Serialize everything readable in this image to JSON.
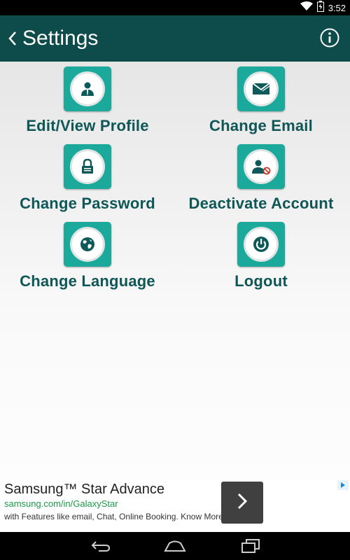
{
  "status_bar": {
    "time": "3:52",
    "icons": [
      "wifi-icon",
      "battery-icon"
    ]
  },
  "app_bar": {
    "title": "Settings",
    "back_icon": "chevron-left-icon",
    "info_icon": "info-icon"
  },
  "tiles": [
    {
      "label": "Edit/View Profile",
      "icon": "profile-icon"
    },
    {
      "label": "Change Email",
      "icon": "email-icon"
    },
    {
      "label": "Change Password",
      "icon": "lock-icon"
    },
    {
      "label": "Deactivate Account",
      "icon": "deactivate-user-icon"
    },
    {
      "label": "Change Language",
      "icon": "globe-icon"
    },
    {
      "label": "Logout",
      "icon": "power-icon"
    }
  ],
  "ad": {
    "title": "Samsung™ Star Advance",
    "url": "samsung.com/in/GalaxyStar",
    "description": "with Features like email, Chat, Online Booking. Know More!",
    "arrow_icon": "chevron-right-icon"
  },
  "nav_bar": {
    "buttons": [
      "back-nav-icon",
      "home-nav-icon",
      "recents-nav-icon"
    ]
  },
  "colors": {
    "app_bar": "#0e4b4b",
    "tile_bg": "#1aa99b",
    "tile_label": "#0f5757",
    "ad_url": "#1a9a4a"
  }
}
